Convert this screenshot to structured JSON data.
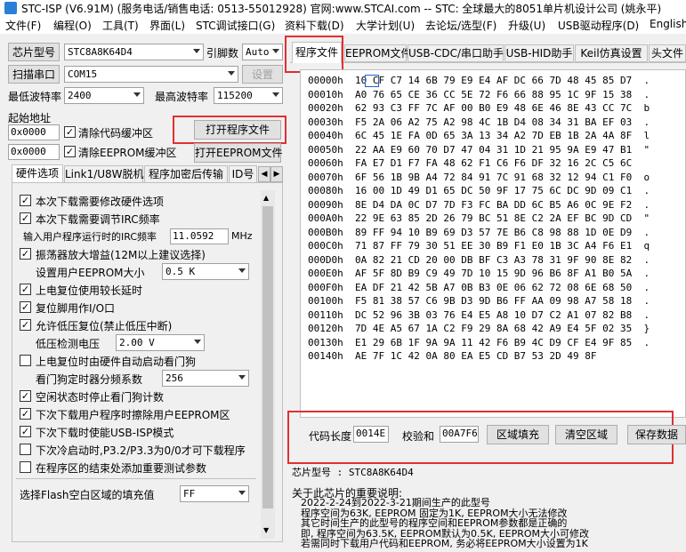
{
  "title": "STC-ISP (V6.91M) (服务电话/销售电话: 0513-55012928) 官网:www.STCAI.com  -- STC: 全球最大的8051单片机设计公司 (姚永平)",
  "menu": [
    "文件(F)",
    "编程(O)",
    "工具(T)",
    "界面(L)",
    "STC调试接口(G)",
    "资料下载(D)",
    "大学计划(U)",
    "去论坛/选型(F)",
    "升级(U)",
    "USB驱动程序(D)",
    "English"
  ],
  "left": {
    "chip_label": "芯片型号",
    "chip_value": "STC8A8K64D4",
    "pin_label": "引脚数",
    "pin_value": "Auto",
    "scan_button": "扫描串口",
    "port_value": "COM15",
    "settings_button": "设置",
    "min_baud_label": "最低波特率",
    "min_baud_value": "2400",
    "max_baud_label": "最高波特率",
    "max_baud_value": "115200",
    "start_addr_label": "起始地址",
    "addr1": "0x0000",
    "clear_code_label": "清除代码缓冲区",
    "open_prog_button": "打开程序文件",
    "addr2": "0x0000",
    "clear_eeprom_label": "清除EEPROM缓冲区",
    "open_eeprom_button": "打开EEPROM文件"
  },
  "hw_tabs": [
    "硬件选项",
    "Link1/U8W脱机",
    "程序加密后传输",
    "ID号"
  ],
  "options": [
    {
      "label": "本次下载需要修改硬件选项",
      "checked": true,
      "indent": 0
    },
    {
      "label": "本次下载需要调节IRC频率",
      "checked": true,
      "indent": 0
    },
    {
      "label": "输入用户程序运行时的IRC频率",
      "checked": null,
      "indent": 1,
      "input": "11.0592",
      "unit": "MHz"
    },
    {
      "label": "振荡器放大增益(12M以上建议选择)",
      "checked": true,
      "indent": 0
    },
    {
      "label": "设置用户EEPROM大小",
      "checked": null,
      "indent": 2,
      "select": "0.5 K"
    },
    {
      "label": "上电复位使用较长延时",
      "checked": true,
      "indent": 0
    },
    {
      "label": "复位脚用作I/O口",
      "checked": true,
      "indent": 0
    },
    {
      "label": "允许低压复位(禁止低压中断)",
      "checked": true,
      "indent": 0
    },
    {
      "label": "低压检测电压",
      "checked": null,
      "indent": 2,
      "select": "2.00 V"
    },
    {
      "label": "上电复位时由硬件自动启动看门狗",
      "checked": false,
      "indent": 0
    },
    {
      "label": "看门狗定时器分频系数",
      "checked": null,
      "indent": 2,
      "select": "256"
    },
    {
      "label": "空闲状态时停止看门狗计数",
      "checked": true,
      "indent": 0
    },
    {
      "label": "下次下载用户程序时擦除用户EEPROM区",
      "checked": true,
      "indent": 0
    },
    {
      "label": "下次下载时使能USB-ISP模式",
      "checked": true,
      "indent": 0
    },
    {
      "label": "下次冷启动时,P3.2/P3.3为0/0才可下载程序",
      "checked": false,
      "indent": 0
    },
    {
      "label": "在程序区的结束处添加重要测试参数",
      "checked": false,
      "indent": 0
    }
  ],
  "flash_fill_label": "选择Flash空白区域的填充值",
  "flash_fill_value": "FF",
  "right_tabs": [
    "程序文件",
    "EEPROM文件",
    "USB-CDC/串口助手",
    "USB-HID助手",
    "Keil仿真设置",
    "头文件"
  ],
  "hex_rows": [
    {
      "addr": "00000h",
      "bytes": "10 CF C7 14 6B 79 E9 E4 AF DC 66 7D 48 45 85 D7",
      "ascii": "."
    },
    {
      "addr": "00010h",
      "bytes": "A0 76 65 CE 36 CC 5E 72 F6 66 88 95 1C 9F 15 38",
      "ascii": "."
    },
    {
      "addr": "00020h",
      "bytes": "62 93 C3 FF 7C AF 00 B0 E9 48 6E 46 8E 43 CC 7C",
      "ascii": "b"
    },
    {
      "addr": "00030h",
      "bytes": "F5 2A 06 A2 75 A2 98 4C 1B D4 08 34 31 BA EF 03",
      "ascii": "."
    },
    {
      "addr": "00040h",
      "bytes": "6C 45 1E FA 0D 65 3A 13 34 A2 7D EB 1B 2A 4A 8F",
      "ascii": "l"
    },
    {
      "addr": "00050h",
      "bytes": "22 AA E9 60 70 D7 47 04 31 1D 21 95 9A E9 47 B1",
      "ascii": "\""
    },
    {
      "addr": "00060h",
      "bytes": "FA E7 D1 F7 FA 48 62 F1 C6 F6 DF 32 16 2C C5 6C",
      "ascii": ""
    },
    {
      "addr": "00070h",
      "bytes": "6F 56 1B 9B A4 72 84 91 7C 91 68 32 12 94 C1 F0",
      "ascii": "o"
    },
    {
      "addr": "00080h",
      "bytes": "16 00 1D 49 D1 65 DC 50 9F 17 75 6C DC 9D 09 C1",
      "ascii": "."
    },
    {
      "addr": "00090h",
      "bytes": "8E D4 DA 0C D7 7D F3 FC BA DD 6C B5 A6 0C 9E F2",
      "ascii": "."
    },
    {
      "addr": "000A0h",
      "bytes": "22 9E 63 85 2D 26 79 BC 51 8E C2 2A EF BC 9D CD",
      "ascii": "\""
    },
    {
      "addr": "000B0h",
      "bytes": "89 FF 94 10 B9 69 D3 57 7E B6 C8 98 88 1D 0E D9",
      "ascii": "."
    },
    {
      "addr": "000C0h",
      "bytes": "71 87 FF 79 30 51 EE 30 B9 F1 E0 1B 3C A4 F6 E1",
      "ascii": "q"
    },
    {
      "addr": "000D0h",
      "bytes": "0A 82 21 CD 20 00 DB BF C3 A3 78 31 9F 90 8E 82",
      "ascii": "."
    },
    {
      "addr": "000E0h",
      "bytes": "AF 5F 8D B9 C9 49 7D 10 15 9D 96 B6 8F A1 B0 5A",
      "ascii": "."
    },
    {
      "addr": "000F0h",
      "bytes": "EA DF 21 42 5B A7 0B B3 0E 06 62 72 08 6E 68 50",
      "ascii": "."
    },
    {
      "addr": "00100h",
      "bytes": "F5 81 38 57 C6 9B D3 9D B6 FF AA 09 98 A7 58 18",
      "ascii": "."
    },
    {
      "addr": "00110h",
      "bytes": "DC 52 96 3B 03 76 E4 E5 A8 10 D7 C2 A1 07 82 B8",
      "ascii": "."
    },
    {
      "addr": "00120h",
      "bytes": "7D 4E A5 67 1A C2 F9 29 8A 68 42 A9 E4 5F 02 35",
      "ascii": "}"
    },
    {
      "addr": "00130h",
      "bytes": "E1 29 6B 1F 9A 9A 11 42 F6 B9 4C D9 CF E4 9F 85",
      "ascii": "."
    },
    {
      "addr": "00140h",
      "bytes": "AE 7F 1C 42 0A 80 EA E5 CD B7 53 2D 49 8F",
      "ascii": ""
    }
  ],
  "bottom": {
    "code_len_label": "代码长度",
    "code_len_value": "0014E",
    "checksum_label": "校验和",
    "checksum_value": "00A7F6",
    "fill_button": "区域填充",
    "clear_button": "清空区域",
    "save_button": "保存数据"
  },
  "info": {
    "chip_line": "芯片型号 : STC8A8K64D4",
    "header": "关于此芯片的重要说明:",
    "lines": [
      "2022-2-24到2022-3-21期间生产的此型号",
      "程序空间为63K, EEPROM 固定为1K, EEPROM大小无法修改",
      "其它时间生产的此型号的程序空间和EEPROM参数都是正确的",
      "即, 程序空间为63.5K, EEPROM默认为0.5K, EEPROM大小可修改",
      "若需同时下载用户代码和EEPROM, 务必将EEPROM大小设置为1K"
    ]
  }
}
